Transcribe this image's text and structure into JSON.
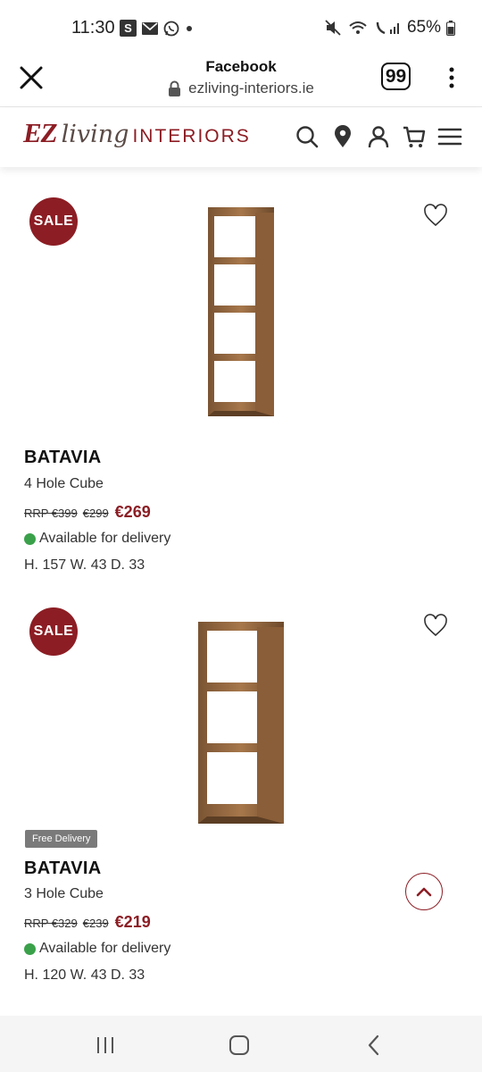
{
  "status_bar": {
    "time": "11:30",
    "s_label": "S",
    "battery": "65%"
  },
  "browser": {
    "title": "Facebook",
    "url": "ezliving-interiors.ie",
    "tab_count": "99"
  },
  "site": {
    "logo_ez": "EZ",
    "logo_living": "living",
    "logo_interiors": "INTERIORS",
    "brand_color": "#8c1d24"
  },
  "products": [
    {
      "sale_label": "SALE",
      "brand": "BATAVIA",
      "name": "4 Hole Cube",
      "rrp": "RRP €399",
      "was": "€299",
      "price": "€269",
      "availability": "Available for delivery",
      "dimensions": "H. 157 W. 43 D. 33"
    },
    {
      "sale_label": "SALE",
      "free_delivery": "Free Delivery",
      "brand": "BATAVIA",
      "name": "3 Hole Cube",
      "rrp": "RRP €329",
      "was": "€239",
      "price": "€219",
      "availability": "Available for delivery",
      "dimensions": "H. 120 W. 43 D. 33"
    }
  ]
}
